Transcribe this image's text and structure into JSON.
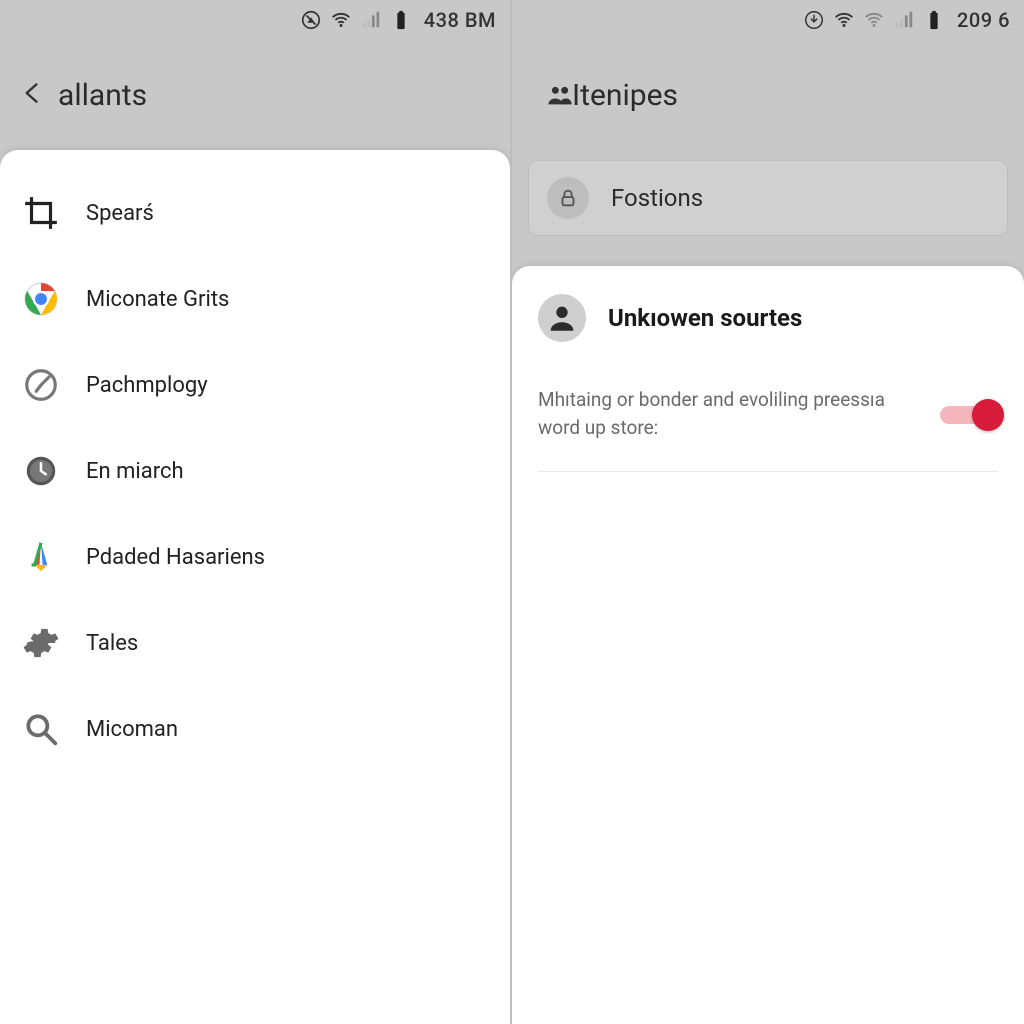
{
  "left": {
    "statusbar": {
      "time": "438 BM"
    },
    "header": {
      "title": "allants"
    },
    "menu": [
      {
        "label": "Spearś",
        "icon": "crop-icon"
      },
      {
        "label": "Miconate Grits",
        "icon": "chrome-icon"
      },
      {
        "label": "Pachmplogy",
        "icon": "dial-icon"
      },
      {
        "label": "En miarch",
        "icon": "clock-icon"
      },
      {
        "label": "Pdaded Hasariens",
        "icon": "triangle-icon"
      },
      {
        "label": "Tales",
        "icon": "gear-icon"
      },
      {
        "label": "Micoman",
        "icon": "search-icon"
      }
    ]
  },
  "right": {
    "statusbar": {
      "time": "209 6"
    },
    "header": {
      "title": "Itenipes"
    },
    "subbar": {
      "label": "Fostions"
    },
    "card": {
      "title": "Unkıowen sourtes",
      "description": "Mhıtaing or bonder and evoliling preessıa word up store:",
      "toggle_on": true
    }
  },
  "colors": {
    "accent": "#d81b3a",
    "accent_light": "#f6b6bd"
  }
}
